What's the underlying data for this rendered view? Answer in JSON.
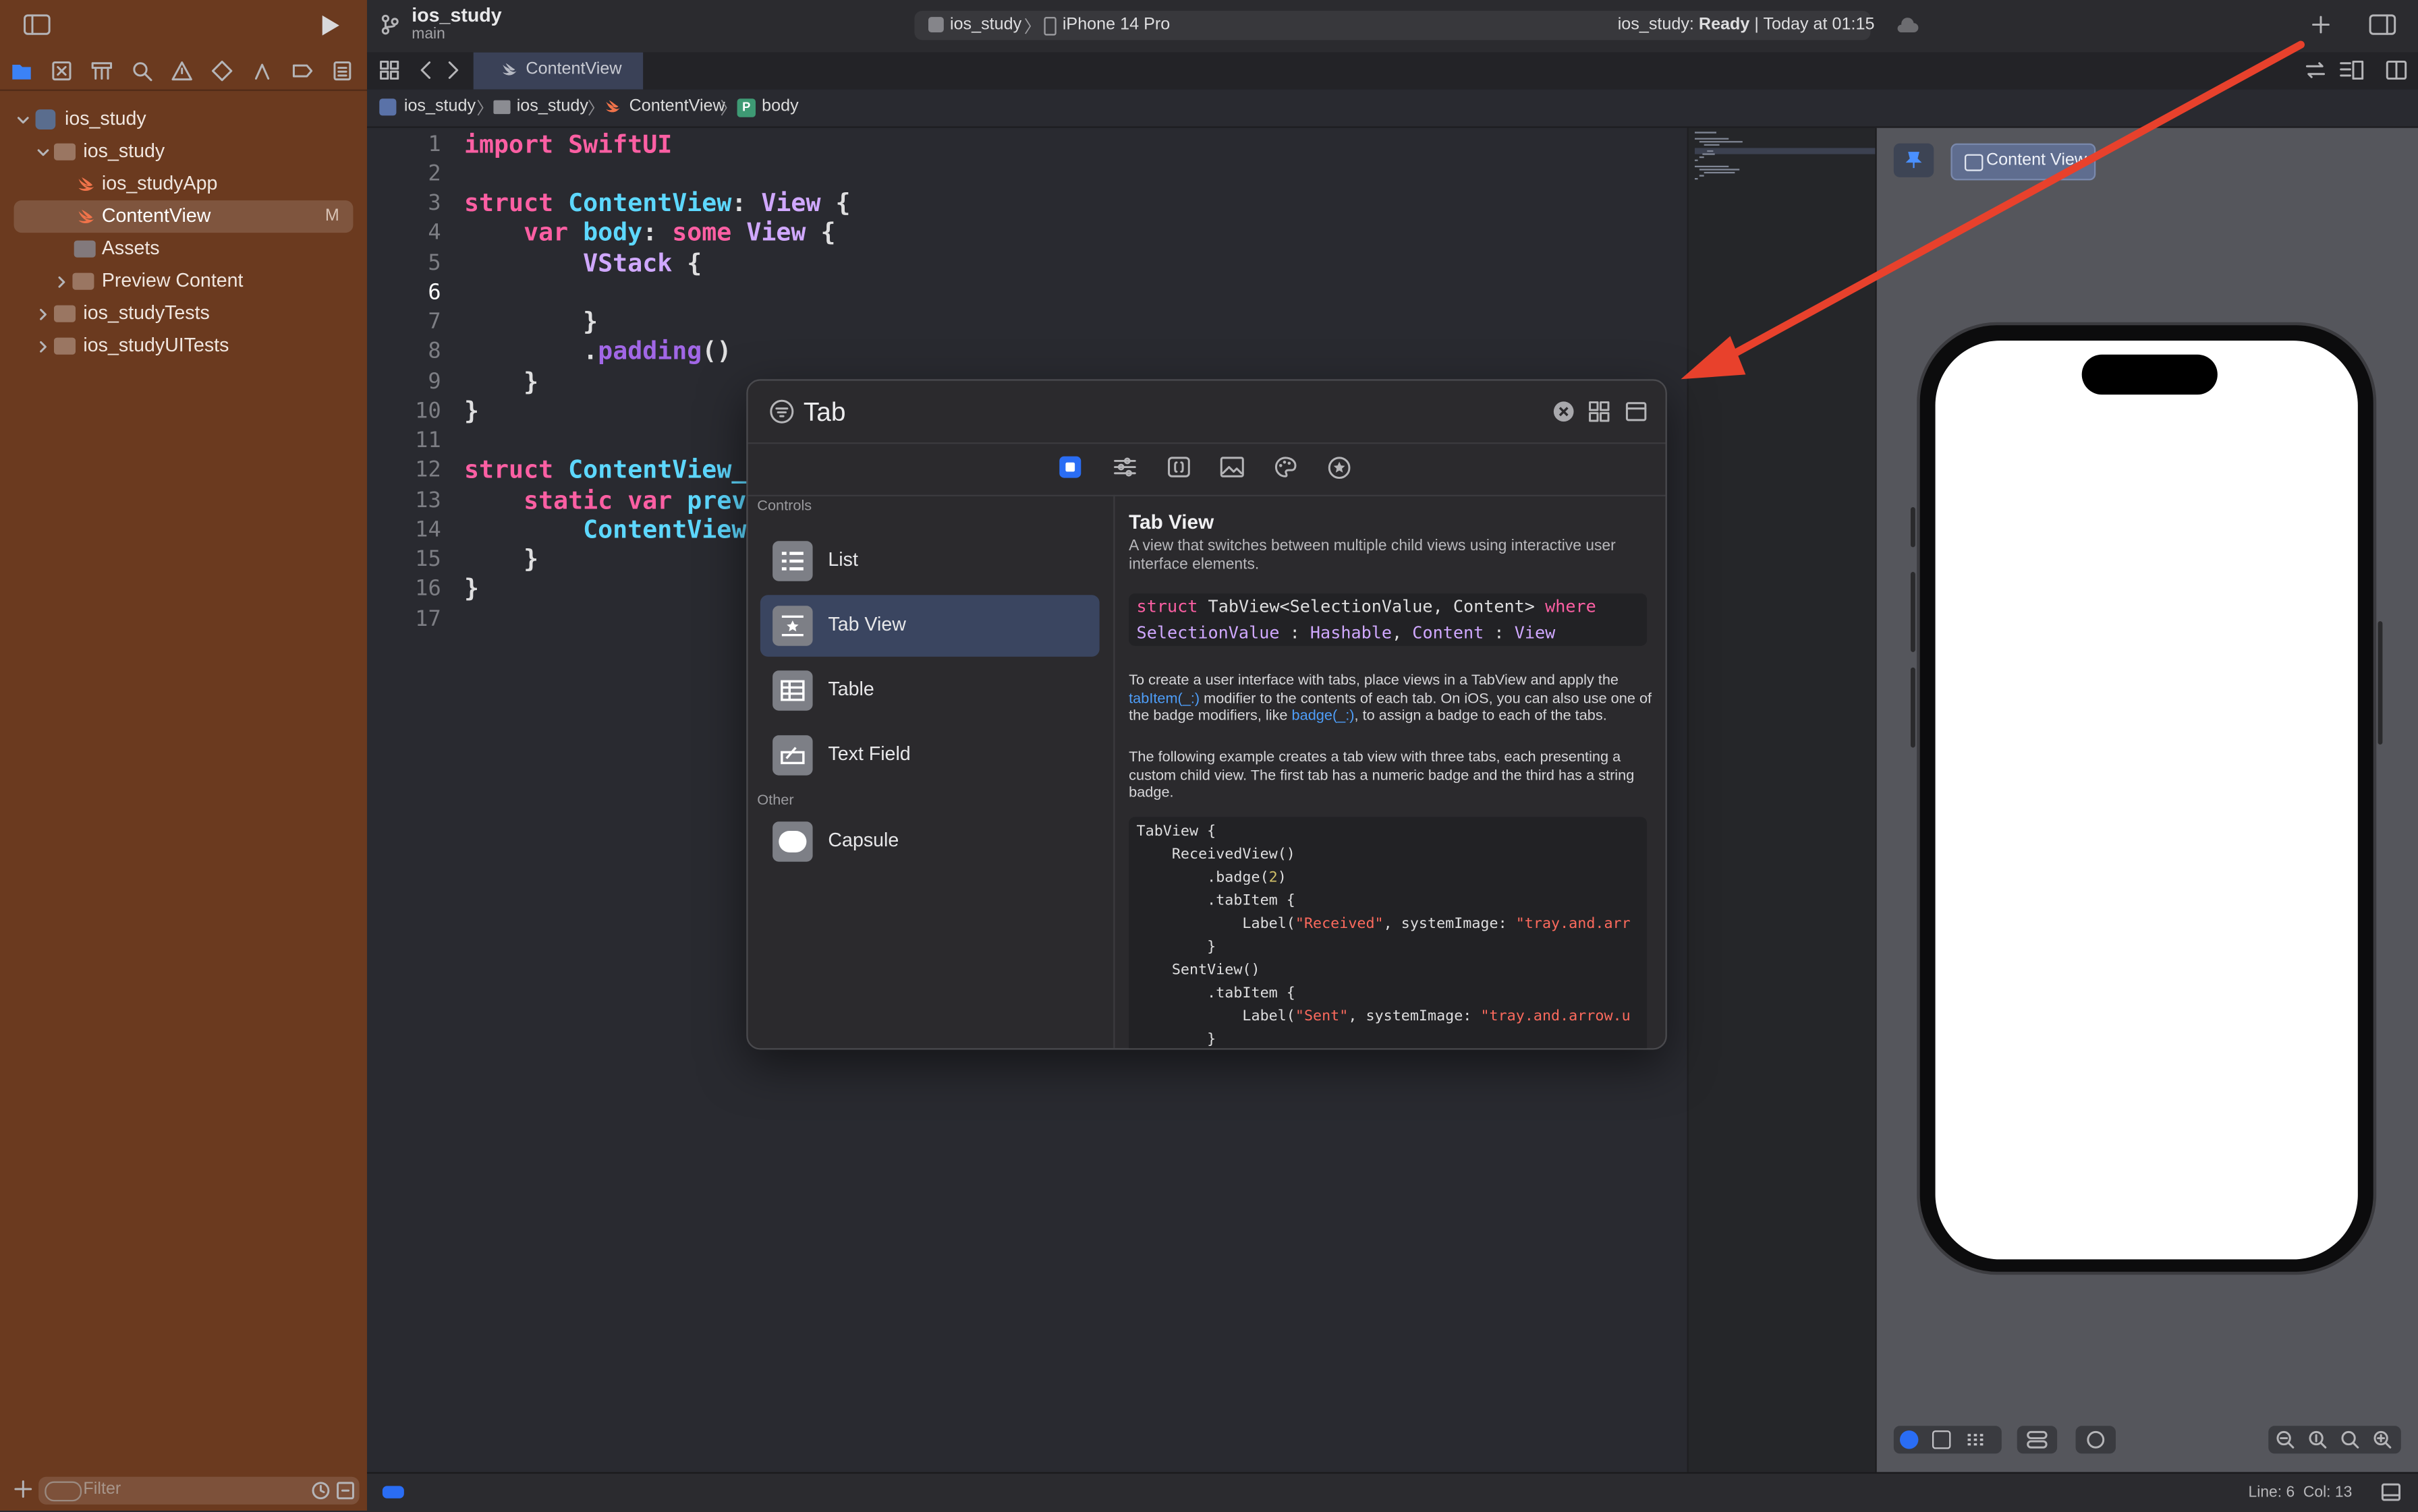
{
  "window": {
    "project": "ios_study",
    "branch": "main",
    "scheme": "ios_study",
    "destination": "iPhone 14 Pro",
    "status_project": "ios_study:",
    "status_state": "Ready",
    "status_time": "| Today at 01:15"
  },
  "sidebar": {
    "items": [
      {
        "label": "ios_study",
        "kind": "project"
      },
      {
        "label": "ios_study",
        "kind": "folder"
      },
      {
        "label": "ios_studyApp",
        "kind": "swift"
      },
      {
        "label": "ContentView",
        "kind": "swift",
        "badge": "M",
        "selected": true
      },
      {
        "label": "Assets",
        "kind": "assets"
      },
      {
        "label": "Preview Content",
        "kind": "folder"
      },
      {
        "label": "ios_studyTests",
        "kind": "folder"
      },
      {
        "label": "ios_studyUITests",
        "kind": "folder"
      }
    ],
    "filter_placeholder": "Filter"
  },
  "editor": {
    "tab": "ContentView",
    "breadcrumb": [
      "ios_study",
      "ios_study",
      "ContentView",
      "body"
    ],
    "line_numbers": [
      "1",
      "2",
      "3",
      "4",
      "5",
      "6",
      "7",
      "8",
      "9",
      "10",
      "11",
      "12",
      "13",
      "14",
      "15",
      "16",
      "17"
    ],
    "code": {
      "l1": "import SwiftUI",
      "l3a": "struct ",
      "l3b": "ContentView",
      "l3c": ": ",
      "l3d": "View",
      "l3e": " {",
      "l4a": "    var ",
      "l4b": "body",
      "l4c": ": ",
      "l4d": "some",
      "l4e": " ",
      "l4f": "View",
      "l4g": " {",
      "l5a": "        ",
      "l5b": "VStack",
      "l5c": " {",
      "l7": "        }",
      "l8a": "        .",
      "l8b": "padding",
      "l8c": "()",
      "l9": "    }",
      "l10": "}",
      "l12a": "struct ",
      "l12b": "ContentView_",
      "l13a": "    static var ",
      "l13b": "prev",
      "l14a": "        ",
      "l14b": "ContentView",
      "l15": "    }",
      "l16": "}"
    }
  },
  "library": {
    "search_value": "Tab",
    "sections": {
      "controls": "Controls",
      "other": "Other"
    },
    "items": [
      "List",
      "Tab View",
      "Table",
      "Text Field"
    ],
    "other_items": [
      "Capsule"
    ],
    "detail": {
      "title": "Tab View",
      "subtitle": "A view that switches between multiple child views using interactive user interface elements.",
      "decl_1a": "struct",
      "decl_1b": " TabView<SelectionValue, Content> ",
      "decl_1c": "where",
      "decl_2a": "SelectionValue",
      "decl_2b": " : ",
      "decl_2c": "Hashable",
      "decl_2d": ", ",
      "decl_2e": "Content",
      "decl_2f": " : ",
      "decl_2g": "View",
      "p1a": "To create a user interface with tabs, place views in a TabView and apply the ",
      "p1_link1": "tabItem(_:)",
      "p1b": " modifier to the contents of each tab. On iOS, you can also use one of the badge modifiers, like ",
      "p1_link2": "badge(_:)",
      "p1c": ", to assign a badge to each of the tabs.",
      "p2": "The following example creates a tab view with three tabs, each presenting a custom child view. The first tab has a numeric badge and the third has a string badge.",
      "s1": "TabView {",
      "s2": "    ReceivedView()",
      "s3a": "        .badge(",
      "s3b": "2",
      "s3c": ")",
      "s4": "        .tabItem {",
      "s5a": "            Label(",
      "s5b": "\"Received\"",
      "s5c": ", systemImage: ",
      "s5d": "\"tray.and.arr",
      "s6": "        }",
      "s7": "    SentView()",
      "s8": "        .tabItem {",
      "s9a": "            Label(",
      "s9b": "\"Sent\"",
      "s9c": ", systemImage: ",
      "s9d": "\"tray.and.arrow.u",
      "s10": "        }"
    }
  },
  "preview": {
    "pin_label": "Content View"
  },
  "statusbar": {
    "position": "Line: 6  Col: 13"
  },
  "colors": {
    "sidebar_bg": "#6b3a1f",
    "editor_bg": "#292a30",
    "keyword": "#fc5fa3",
    "type": "#5dd8ff",
    "accent": "#2a6df4",
    "annotation_arrow": "#e8412c"
  }
}
